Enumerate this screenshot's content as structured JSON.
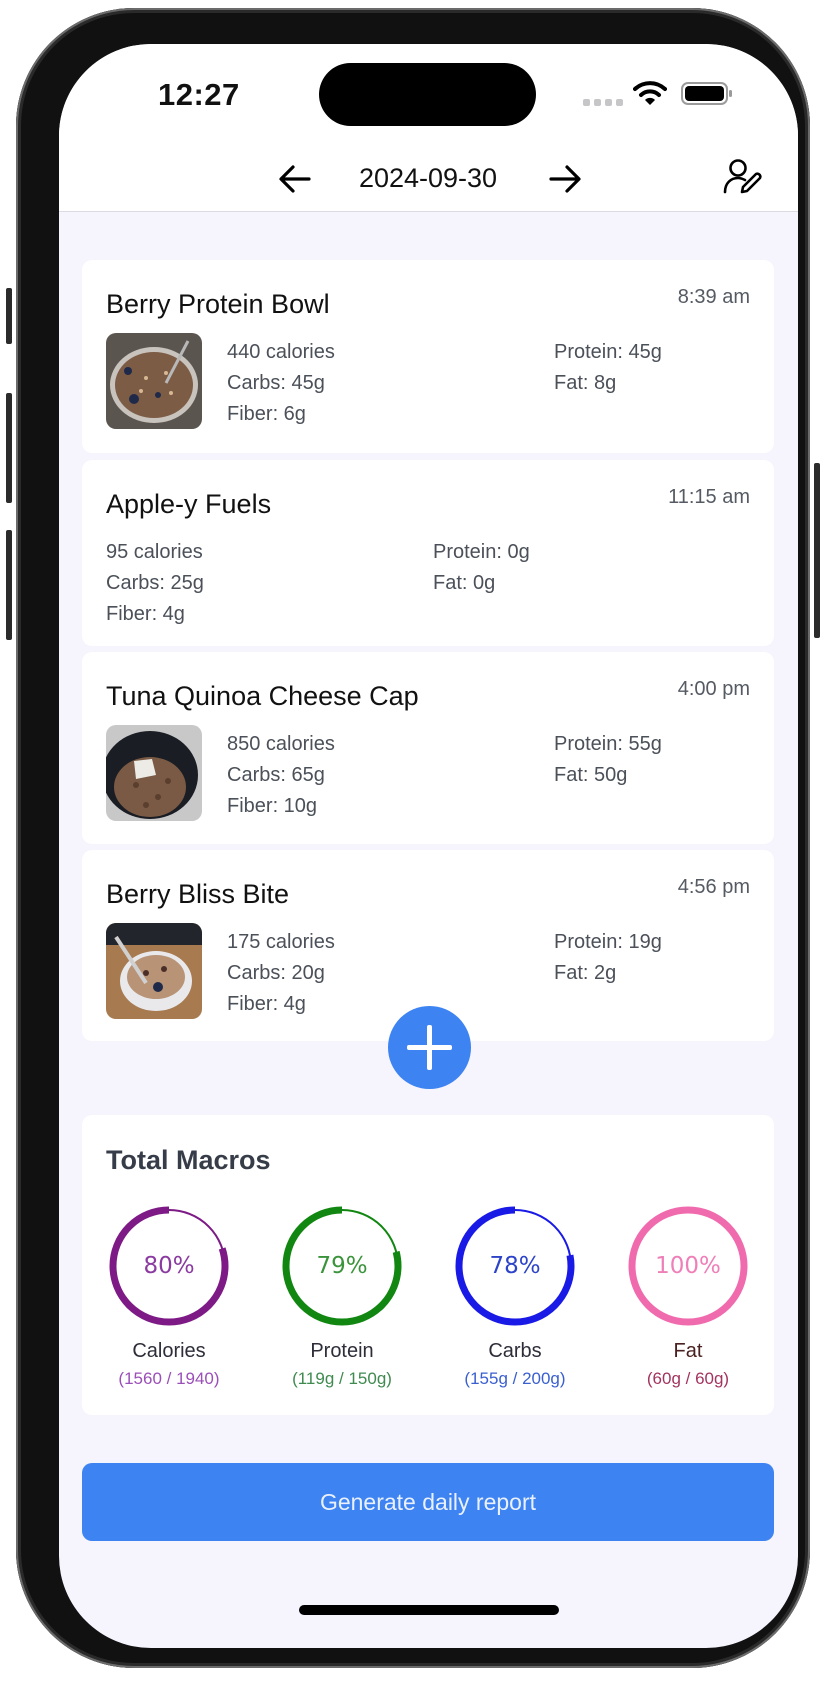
{
  "status_bar": {
    "time": "12:27"
  },
  "header": {
    "date": "2024-09-30",
    "prev_icon": "arrow-left-icon",
    "next_icon": "arrow-right-icon",
    "profile_icon": "user-edit-icon"
  },
  "meals": [
    {
      "name": "Berry Protein Bowl",
      "time": "8:39 am",
      "has_photo": true,
      "calories": "440 calories",
      "carbs": "Carbs: 45g",
      "fiber": "Fiber: 6g",
      "protein": "Protein: 45g",
      "fat": "Fat: 8g"
    },
    {
      "name": "Apple-y Fuels",
      "time": "11:15 am",
      "has_photo": false,
      "calories": "95 calories",
      "carbs": "Carbs: 25g",
      "fiber": "Fiber: 4g",
      "protein": "Protein: 0g",
      "fat": "Fat: 0g"
    },
    {
      "name": "Tuna Quinoa Cheese Cap",
      "time": "4:00 pm",
      "has_photo": true,
      "calories": "850 calories",
      "carbs": "Carbs: 65g",
      "fiber": "Fiber: 10g",
      "protein": "Protein: 55g",
      "fat": "Fat: 50g"
    },
    {
      "name": "Berry Bliss Bite",
      "time": "4:56 pm",
      "has_photo": true,
      "calories": "175 calories",
      "carbs": "Carbs: 20g",
      "fiber": "Fiber: 4g",
      "protein": "Protein: 19g",
      "fat": "Fat: 2g"
    }
  ],
  "add_button": {
    "icon": "plus-icon"
  },
  "macros": {
    "title": "Total Macros",
    "items": [
      {
        "label": "Calories",
        "percent_text": "80%",
        "progress": 0.8,
        "detail": "(1560 / 1940)",
        "color": "#7d1a86",
        "text_color": "#8a3aa0",
        "sub_color": "#9b4fb8",
        "label_color": "#2e2e3a"
      },
      {
        "label": "Protein",
        "percent_text": "79%",
        "progress": 0.79,
        "detail": "(119g / 150g)",
        "color": "#118711",
        "text_color": "#3b943b",
        "sub_color": "#3f8a4f",
        "label_color": "#2e2e3a"
      },
      {
        "label": "Carbs",
        "percent_text": "78%",
        "progress": 0.78,
        "detail": "(155g / 200g)",
        "color": "#1a1ae6",
        "text_color": "#2d44c8",
        "sub_color": "#3a5fcf",
        "label_color": "#2e2e3a"
      },
      {
        "label": "Fat",
        "percent_text": "100%",
        "progress": 1.0,
        "detail": "(60g / 60g)",
        "color": "#f06aae",
        "text_color": "#ef7fb8",
        "sub_color": "#a3345f",
        "label_color": "#4a2020"
      }
    ]
  },
  "report_button": {
    "label": "Generate daily report"
  }
}
